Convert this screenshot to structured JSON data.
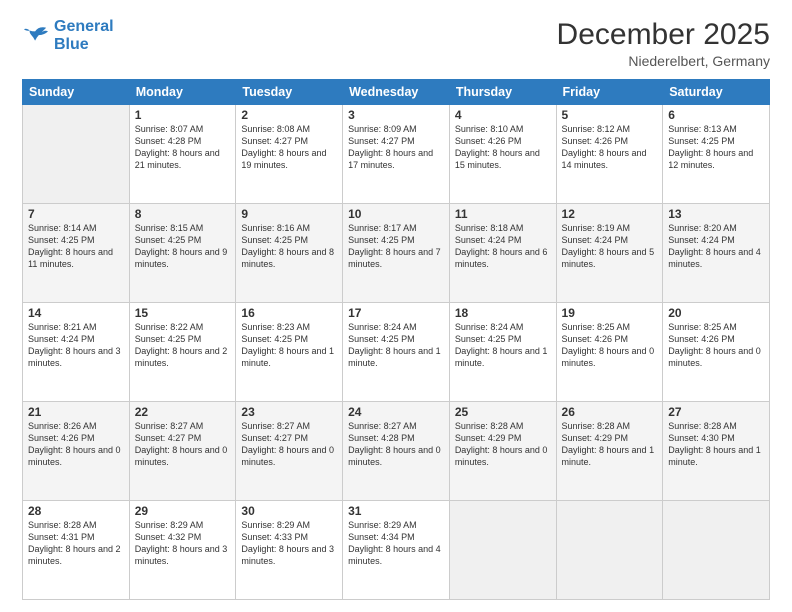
{
  "header": {
    "logo_line1": "General",
    "logo_line2": "Blue",
    "month": "December 2025",
    "location": "Niederelbert, Germany"
  },
  "weekdays": [
    "Sunday",
    "Monday",
    "Tuesday",
    "Wednesday",
    "Thursday",
    "Friday",
    "Saturday"
  ],
  "weeks": [
    [
      {
        "day": "",
        "sunrise": "",
        "sunset": "",
        "daylight": ""
      },
      {
        "day": "1",
        "sunrise": "Sunrise: 8:07 AM",
        "sunset": "Sunset: 4:28 PM",
        "daylight": "Daylight: 8 hours and 21 minutes."
      },
      {
        "day": "2",
        "sunrise": "Sunrise: 8:08 AM",
        "sunset": "Sunset: 4:27 PM",
        "daylight": "Daylight: 8 hours and 19 minutes."
      },
      {
        "day": "3",
        "sunrise": "Sunrise: 8:09 AM",
        "sunset": "Sunset: 4:27 PM",
        "daylight": "Daylight: 8 hours and 17 minutes."
      },
      {
        "day": "4",
        "sunrise": "Sunrise: 8:10 AM",
        "sunset": "Sunset: 4:26 PM",
        "daylight": "Daylight: 8 hours and 15 minutes."
      },
      {
        "day": "5",
        "sunrise": "Sunrise: 8:12 AM",
        "sunset": "Sunset: 4:26 PM",
        "daylight": "Daylight: 8 hours and 14 minutes."
      },
      {
        "day": "6",
        "sunrise": "Sunrise: 8:13 AM",
        "sunset": "Sunset: 4:25 PM",
        "daylight": "Daylight: 8 hours and 12 minutes."
      }
    ],
    [
      {
        "day": "7",
        "sunrise": "Sunrise: 8:14 AM",
        "sunset": "Sunset: 4:25 PM",
        "daylight": "Daylight: 8 hours and 11 minutes."
      },
      {
        "day": "8",
        "sunrise": "Sunrise: 8:15 AM",
        "sunset": "Sunset: 4:25 PM",
        "daylight": "Daylight: 8 hours and 9 minutes."
      },
      {
        "day": "9",
        "sunrise": "Sunrise: 8:16 AM",
        "sunset": "Sunset: 4:25 PM",
        "daylight": "Daylight: 8 hours and 8 minutes."
      },
      {
        "day": "10",
        "sunrise": "Sunrise: 8:17 AM",
        "sunset": "Sunset: 4:25 PM",
        "daylight": "Daylight: 8 hours and 7 minutes."
      },
      {
        "day": "11",
        "sunrise": "Sunrise: 8:18 AM",
        "sunset": "Sunset: 4:24 PM",
        "daylight": "Daylight: 8 hours and 6 minutes."
      },
      {
        "day": "12",
        "sunrise": "Sunrise: 8:19 AM",
        "sunset": "Sunset: 4:24 PM",
        "daylight": "Daylight: 8 hours and 5 minutes."
      },
      {
        "day": "13",
        "sunrise": "Sunrise: 8:20 AM",
        "sunset": "Sunset: 4:24 PM",
        "daylight": "Daylight: 8 hours and 4 minutes."
      }
    ],
    [
      {
        "day": "14",
        "sunrise": "Sunrise: 8:21 AM",
        "sunset": "Sunset: 4:24 PM",
        "daylight": "Daylight: 8 hours and 3 minutes."
      },
      {
        "day": "15",
        "sunrise": "Sunrise: 8:22 AM",
        "sunset": "Sunset: 4:25 PM",
        "daylight": "Daylight: 8 hours and 2 minutes."
      },
      {
        "day": "16",
        "sunrise": "Sunrise: 8:23 AM",
        "sunset": "Sunset: 4:25 PM",
        "daylight": "Daylight: 8 hours and 1 minute."
      },
      {
        "day": "17",
        "sunrise": "Sunrise: 8:24 AM",
        "sunset": "Sunset: 4:25 PM",
        "daylight": "Daylight: 8 hours and 1 minute."
      },
      {
        "day": "18",
        "sunrise": "Sunrise: 8:24 AM",
        "sunset": "Sunset: 4:25 PM",
        "daylight": "Daylight: 8 hours and 1 minute."
      },
      {
        "day": "19",
        "sunrise": "Sunrise: 8:25 AM",
        "sunset": "Sunset: 4:26 PM",
        "daylight": "Daylight: 8 hours and 0 minutes."
      },
      {
        "day": "20",
        "sunrise": "Sunrise: 8:25 AM",
        "sunset": "Sunset: 4:26 PM",
        "daylight": "Daylight: 8 hours and 0 minutes."
      }
    ],
    [
      {
        "day": "21",
        "sunrise": "Sunrise: 8:26 AM",
        "sunset": "Sunset: 4:26 PM",
        "daylight": "Daylight: 8 hours and 0 minutes."
      },
      {
        "day": "22",
        "sunrise": "Sunrise: 8:27 AM",
        "sunset": "Sunset: 4:27 PM",
        "daylight": "Daylight: 8 hours and 0 minutes."
      },
      {
        "day": "23",
        "sunrise": "Sunrise: 8:27 AM",
        "sunset": "Sunset: 4:27 PM",
        "daylight": "Daylight: 8 hours and 0 minutes."
      },
      {
        "day": "24",
        "sunrise": "Sunrise: 8:27 AM",
        "sunset": "Sunset: 4:28 PM",
        "daylight": "Daylight: 8 hours and 0 minutes."
      },
      {
        "day": "25",
        "sunrise": "Sunrise: 8:28 AM",
        "sunset": "Sunset: 4:29 PM",
        "daylight": "Daylight: 8 hours and 0 minutes."
      },
      {
        "day": "26",
        "sunrise": "Sunrise: 8:28 AM",
        "sunset": "Sunset: 4:29 PM",
        "daylight": "Daylight: 8 hours and 1 minute."
      },
      {
        "day": "27",
        "sunrise": "Sunrise: 8:28 AM",
        "sunset": "Sunset: 4:30 PM",
        "daylight": "Daylight: 8 hours and 1 minute."
      }
    ],
    [
      {
        "day": "28",
        "sunrise": "Sunrise: 8:28 AM",
        "sunset": "Sunset: 4:31 PM",
        "daylight": "Daylight: 8 hours and 2 minutes."
      },
      {
        "day": "29",
        "sunrise": "Sunrise: 8:29 AM",
        "sunset": "Sunset: 4:32 PM",
        "daylight": "Daylight: 8 hours and 3 minutes."
      },
      {
        "day": "30",
        "sunrise": "Sunrise: 8:29 AM",
        "sunset": "Sunset: 4:33 PM",
        "daylight": "Daylight: 8 hours and 3 minutes."
      },
      {
        "day": "31",
        "sunrise": "Sunrise: 8:29 AM",
        "sunset": "Sunset: 4:34 PM",
        "daylight": "Daylight: 8 hours and 4 minutes."
      },
      {
        "day": "",
        "sunrise": "",
        "sunset": "",
        "daylight": ""
      },
      {
        "day": "",
        "sunrise": "",
        "sunset": "",
        "daylight": ""
      },
      {
        "day": "",
        "sunrise": "",
        "sunset": "",
        "daylight": ""
      }
    ]
  ]
}
